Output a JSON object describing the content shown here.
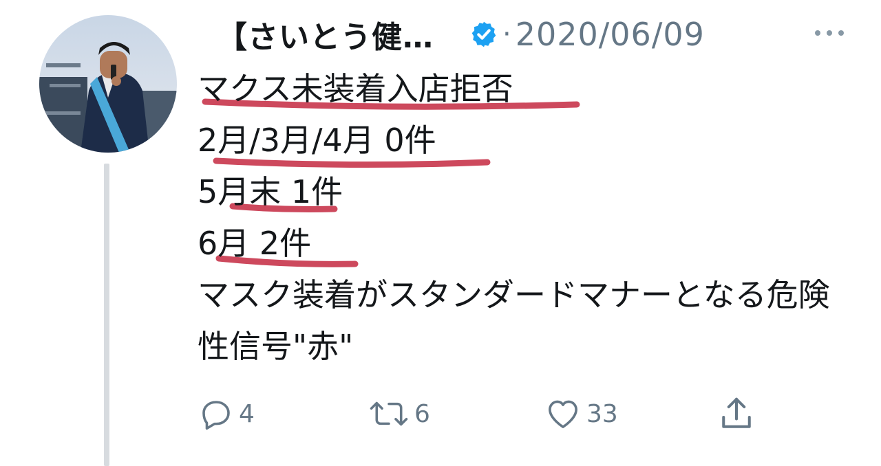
{
  "tweet": {
    "author": {
      "display_name": "【さいとう健…",
      "verified": true
    },
    "separator": "·",
    "date": "2020/06/09",
    "lines": [
      "マクス未装着入店拒否",
      "2月/3月/4月 0件",
      "5月末 1件",
      "6月 2件",
      "マスク装着がスタンダードマナーとなる危険性信号\"赤\""
    ],
    "underline_color": "#c8354b"
  },
  "actions": {
    "reply_count": "4",
    "retweet_count": "6",
    "like_count": "33"
  },
  "icons": {
    "verified": "verified-badge-icon",
    "more": "more-horizontal-icon",
    "reply": "reply-bubble-icon",
    "retweet": "retweet-arrows-icon",
    "like": "heart-icon",
    "share": "share-upload-icon"
  },
  "colors": {
    "text": "#14171a",
    "muted": "#657786",
    "verified_blue": "#1da1f2",
    "thread_line": "#d7dbdf"
  }
}
